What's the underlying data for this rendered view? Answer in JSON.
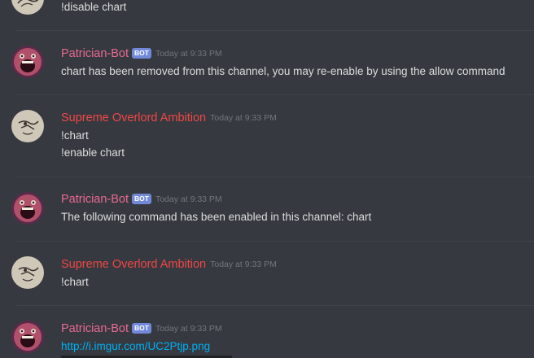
{
  "messages": [
    {
      "author": "",
      "lines": [
        "!disable chart"
      ]
    },
    {
      "author": "Patrician-Bot",
      "bot": "BOT",
      "time": "Today at 9:33 PM",
      "lines": [
        "chart has been removed from this channel, you may re-enable by using the allow command"
      ]
    },
    {
      "author": "Supreme Overlord Ambition",
      "time": "Today at 9:33 PM",
      "lines": [
        "!chart",
        "!enable chart"
      ]
    },
    {
      "author": "Patrician-Bot",
      "bot": "BOT",
      "time": "Today at 9:33 PM",
      "lines": [
        "The following command has been enabled in this channel: chart"
      ]
    },
    {
      "author": "Supreme Overlord Ambition",
      "time": "Today at 9:33 PM",
      "lines": [
        "!chart"
      ]
    },
    {
      "author": "Patrician-Bot",
      "bot": "BOT",
      "time": "Today at 9:33 PM",
      "lines": [
        "http://i.imgur.com/UC2Ptjp.png"
      ]
    }
  ],
  "colors": {
    "background": "#36393f",
    "user_name": "#f04747",
    "bot_name": "#e86a92",
    "bot_tag": "#7289da",
    "timestamp": "#72767d",
    "text": "#dcddde",
    "link": "#00b0f4"
  },
  "icons": {
    "bot_avatar": "screaming-face-avatar",
    "user_avatar": "sketch-drawing-avatar"
  }
}
